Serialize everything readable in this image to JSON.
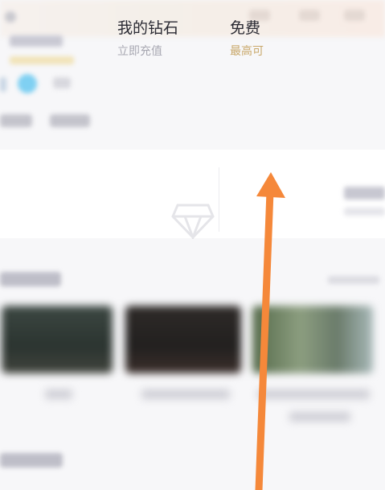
{
  "wallet": {
    "diamond": {
      "title": "我的钻石",
      "subtitle": "立即充值"
    },
    "free": {
      "title": "免费",
      "subtitle": "最高可"
    }
  },
  "colors": {
    "arrow": "#f5883a",
    "gold_text": "#c9a86a",
    "vip_badge": "#7fd0f2"
  },
  "icons": {
    "diamond": "diamond-icon",
    "swipe": "swipe-up-arrow-icon"
  }
}
